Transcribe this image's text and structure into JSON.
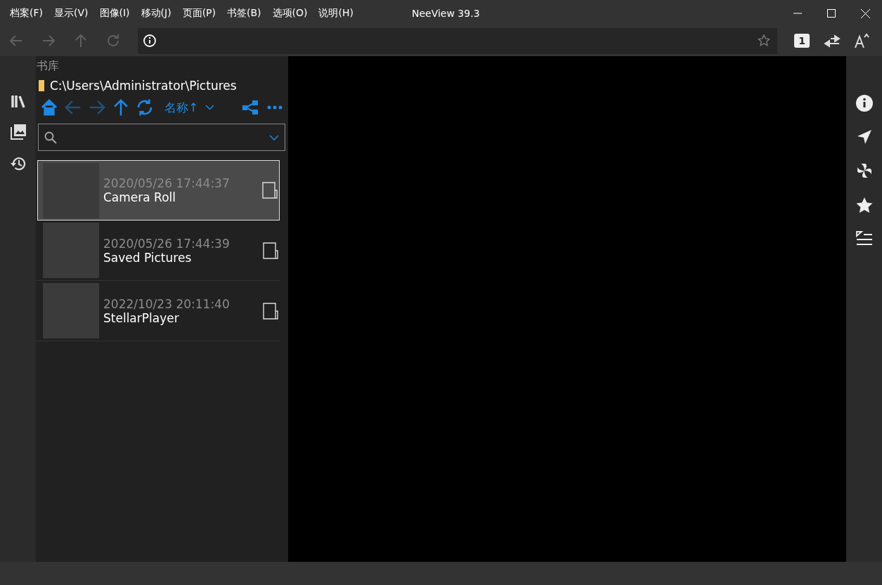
{
  "window": {
    "title": "NeeView 39.3"
  },
  "menu": [
    {
      "label": "档案(F)"
    },
    {
      "label": "显示(V)"
    },
    {
      "label": "图像(I)"
    },
    {
      "label": "移动(J)"
    },
    {
      "label": "页面(P)"
    },
    {
      "label": "书签(B)"
    },
    {
      "label": "选项(O)"
    },
    {
      "label": "说明(H)"
    }
  ],
  "nav_buttons": [
    {
      "kind": "back",
      "disabled": true
    },
    {
      "kind": "forward",
      "disabled": true
    },
    {
      "kind": "up",
      "disabled": true
    },
    {
      "kind": "reload",
      "disabled": true
    }
  ],
  "page_mode": {
    "label": "1"
  },
  "panel": {
    "title": "书库",
    "path": "C:\\Users\\Administrator\\Pictures",
    "tools": [
      {
        "kind": "home",
        "disabled": false
      },
      {
        "kind": "back",
        "disabled": true
      },
      {
        "kind": "forward",
        "disabled": true
      },
      {
        "kind": "up",
        "disabled": false
      },
      {
        "kind": "refresh",
        "disabled": false
      }
    ],
    "sort": {
      "label": "名称↑"
    },
    "items": [
      {
        "date": "2020/05/26 17:44:37",
        "name": "Camera Roll",
        "selected": true
      },
      {
        "date": "2020/05/26 17:44:39",
        "name": "Saved Pictures",
        "selected": false
      },
      {
        "date": "2022/10/23 20:11:40",
        "name": "StellarPlayer",
        "selected": false
      }
    ]
  }
}
